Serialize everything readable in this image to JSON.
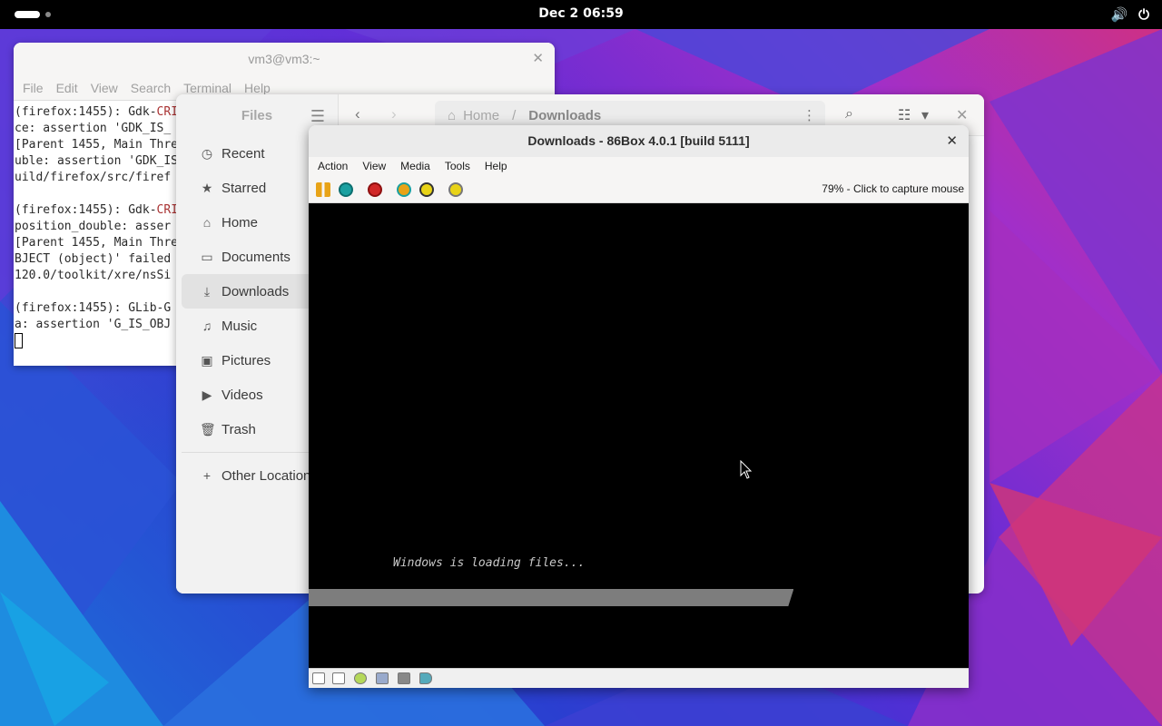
{
  "topbar": {
    "clock": "Dec 2  06:59",
    "volume_icon": "speaker-icon",
    "power_icon": "power-icon"
  },
  "terminal": {
    "title": "vm3@vm3:~",
    "menu": [
      "File",
      "Edit",
      "View",
      "Search",
      "Terminal",
      "Help"
    ],
    "lines": [
      {
        "pre": "(firefox:1455): Gdk-",
        "red": "CRI",
        "post": ""
      },
      {
        "pre": "ce: assertion 'GDK_IS_",
        "red": "",
        "post": ""
      },
      {
        "pre": "[Parent 1455, Main Thre",
        "red": "",
        "post": ""
      },
      {
        "pre": "uble: assertion 'GDK_IS",
        "red": "",
        "post": ""
      },
      {
        "pre": "uild/firefox/src/firef",
        "red": "",
        "post": ""
      },
      {
        "pre": "",
        "red": "",
        "post": ""
      },
      {
        "pre": "(firefox:1455): Gdk-",
        "red": "CRI",
        "post": ""
      },
      {
        "pre": "position_double: asser",
        "red": "",
        "post": ""
      },
      {
        "pre": "[Parent 1455, Main Thre",
        "red": "",
        "post": ""
      },
      {
        "pre": "BJECT (object)' failed",
        "red": "",
        "post": ""
      },
      {
        "pre": "120.0/toolkit/xre/nsSi",
        "red": "",
        "post": ""
      },
      {
        "pre": "",
        "red": "",
        "post": ""
      },
      {
        "pre": "(firefox:1455): GLib-G",
        "red": "",
        "post": ""
      },
      {
        "pre": "a: assertion 'G_IS_OBJ",
        "red": "",
        "post": ""
      }
    ]
  },
  "files": {
    "sidebar_title": "Files",
    "items": [
      {
        "label": "Recent",
        "icon": "clock-icon",
        "glyph": "◷",
        "active": false
      },
      {
        "label": "Starred",
        "icon": "star-icon",
        "glyph": "★",
        "active": false
      },
      {
        "label": "Home",
        "icon": "home-icon",
        "glyph": "⌂",
        "active": false
      },
      {
        "label": "Documents",
        "icon": "document-icon",
        "glyph": "▭",
        "active": false
      },
      {
        "label": "Downloads",
        "icon": "download-icon",
        "glyph": "⤓",
        "active": true
      },
      {
        "label": "Music",
        "icon": "music-icon",
        "glyph": "♫",
        "active": false
      },
      {
        "label": "Pictures",
        "icon": "picture-icon",
        "glyph": "▣",
        "active": false
      },
      {
        "label": "Videos",
        "icon": "video-icon",
        "glyph": "▶",
        "active": false
      },
      {
        "label": "Trash",
        "icon": "trash-icon",
        "glyph": "🗑",
        "active": false
      }
    ],
    "other_locations": "Other Locations",
    "path": {
      "home": "Home",
      "sep": "/",
      "current": "Downloads"
    }
  },
  "box86": {
    "title": "Downloads - 86Box 4.0.1 [build 5111]",
    "menu": [
      "Action",
      "View",
      "Media",
      "Tools",
      "Help"
    ],
    "status_text": "79% - Click to capture mouse",
    "screen_text": "Windows is loading files...",
    "progress": 0.735,
    "toolbar_icons": [
      "pause-icon",
      "reset-icon",
      "power-off-icon",
      "ctrl-alt-del-icon",
      "ctrl-alt-esc-icon",
      "settings-icon"
    ],
    "statusbar_icons": [
      "floppy-a-icon",
      "floppy-b-icon",
      "cdrom-icon",
      "hdd-icon",
      "network-icon",
      "sound-icon"
    ]
  },
  "colors": {
    "accent_orange": "#e8a317",
    "accent_red": "#d12727",
    "accent_teal": "#1aa0a0"
  }
}
